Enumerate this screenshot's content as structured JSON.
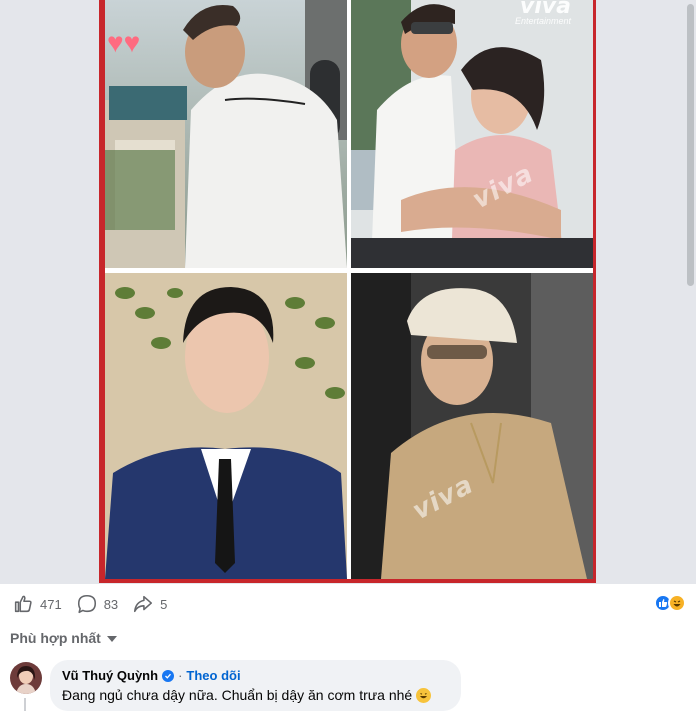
{
  "post": {
    "watermark": "viva",
    "watermark_top": "viva",
    "watermark_sub": "Entertainment"
  },
  "actions": {
    "likes": "471",
    "comments": "83",
    "shares": "5"
  },
  "reactions": [
    "like-icon",
    "haha-icon"
  ],
  "sort": {
    "label": "Phù hợp nhất"
  },
  "comment": {
    "author": "Vũ Thuý Quỳnh",
    "separator": "·",
    "follow": "Theo dõi",
    "text": "Đang ngủ chưa dậy nữa. Chuẩn bị dậy ăn cơm trưa nhé"
  },
  "colors": {
    "frame": "#c7262b",
    "accent": "#1877f2",
    "muted": "#65676b",
    "bubble": "#f0f2f5"
  }
}
